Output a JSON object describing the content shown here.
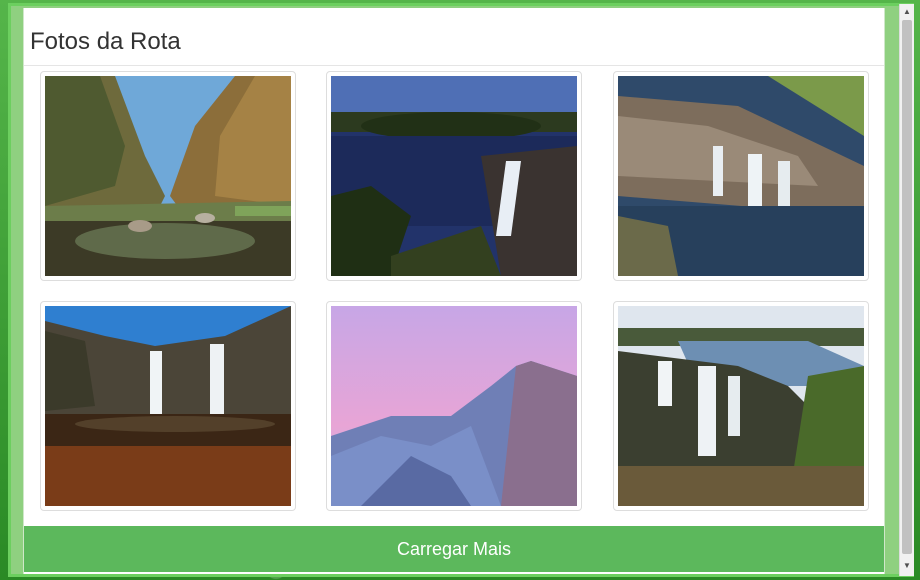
{
  "modal": {
    "title": "Fotos da Rota",
    "load_more_label": "Carregar Mais"
  },
  "photos": [
    {
      "name": "canyon-river"
    },
    {
      "name": "waterfall-lake"
    },
    {
      "name": "aerial-waterfall"
    },
    {
      "name": "twin-waterfalls"
    },
    {
      "name": "pink-mountain"
    },
    {
      "name": "wide-waterfall"
    }
  ],
  "scrollbar": {
    "up_icon": "arrow-up-icon",
    "down_icon": "arrow-down-icon"
  }
}
